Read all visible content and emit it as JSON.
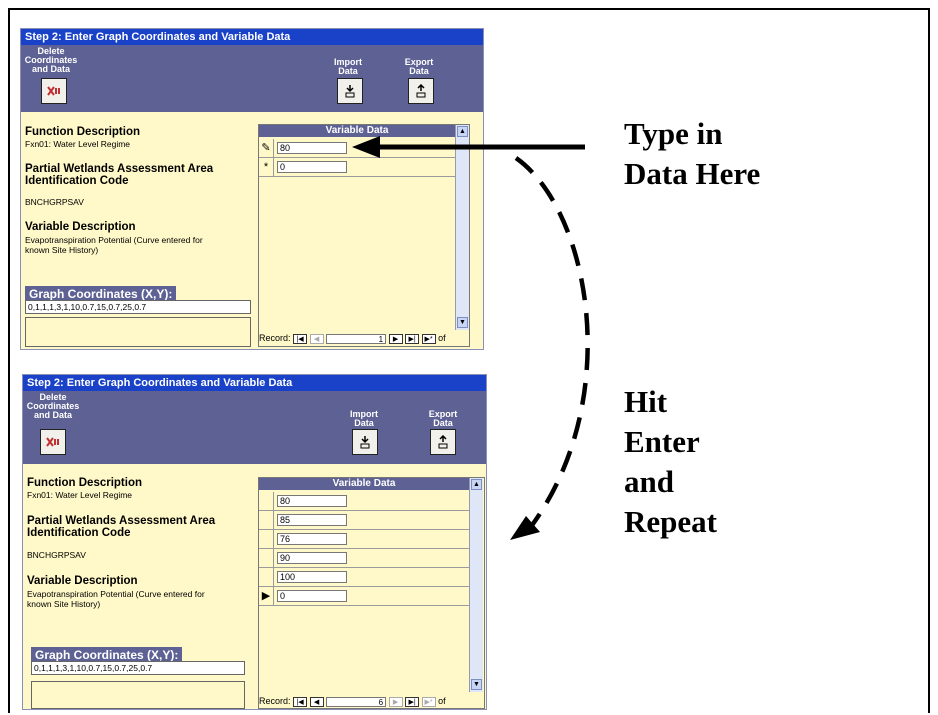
{
  "form": {
    "title": "Step 2: Enter Graph Coordinates and Variable Data",
    "toolbar": {
      "delete_label_1": "Delete",
      "delete_label_2": "Coordinates",
      "delete_label_3": "and Data",
      "import_label_1": "Import",
      "import_label_2": "Data",
      "export_label_1": "Export",
      "export_label_2": "Data"
    },
    "function_heading": "Function Description",
    "function_value": "Fxn01:  Water Level Regime",
    "pwaa_heading_1": "Partial Wetlands Assessment Area",
    "pwaa_heading_2": "Identification Code",
    "pwaa_value": "BNCHGRPSAV",
    "variable_heading": "Variable Description",
    "variable_value_1": "Evapotranspiration Potential (Curve entered for",
    "variable_value_2": "known Site History)",
    "graph_coords_label": "Graph Coordinates (X,Y):",
    "graph_coords_value": "0,1,1,1,3,1,10,0.7,15,0.7,25,0.7",
    "grid_header": "Variable Data",
    "record_label": "Record:",
    "record_of": "of"
  },
  "screen1": {
    "rows": [
      {
        "selector": "✎",
        "value": "80"
      },
      {
        "selector": "*",
        "value": "0"
      }
    ],
    "record_number": "1"
  },
  "screen2": {
    "rows": [
      {
        "selector": "",
        "value": "80"
      },
      {
        "selector": "",
        "value": "85"
      },
      {
        "selector": "",
        "value": "76"
      },
      {
        "selector": "",
        "value": "90"
      },
      {
        "selector": "",
        "value": "100"
      },
      {
        "selector": "▶",
        "value": "0"
      }
    ],
    "record_number": "6"
  },
  "callouts": {
    "type_in_1": "Type in",
    "type_in_2": "Data Here",
    "hit_1": "Hit",
    "hit_2": "Enter",
    "hit_3": "and",
    "hit_4": "Repeat"
  },
  "colors": {
    "title_bar": "#1a42c9",
    "toolbar": "#5d6193",
    "form_background": "#fff8c8"
  }
}
